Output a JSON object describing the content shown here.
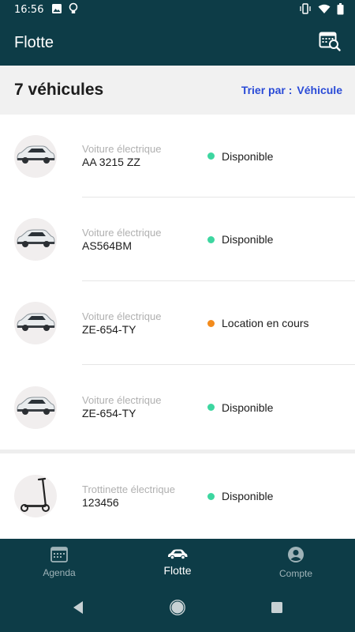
{
  "status_bar": {
    "time": "16:56"
  },
  "app_bar": {
    "title": "Flotte",
    "action_icon": "calendar-search-icon"
  },
  "summary": {
    "count_label": "7 véhicules",
    "sort_prefix": "Trier par :",
    "sort_value": "Véhicule"
  },
  "vehicles": [
    {
      "type": "Voiture électrique",
      "plate": "AA 3215 ZZ",
      "status": "Disponible",
      "status_color": "#3dd6a0",
      "icon": "car-icon"
    },
    {
      "type": "Voiture électrique",
      "plate": "AS564BM",
      "status": "Disponible",
      "status_color": "#3dd6a0",
      "icon": "car-icon"
    },
    {
      "type": "Voiture électrique",
      "plate": "ZE-654-TY",
      "status": "Location en cours",
      "status_color": "#f38b1c",
      "icon": "car-icon"
    },
    {
      "type": "Voiture électrique",
      "plate": "ZE-654-TY",
      "status": "Disponible",
      "status_color": "#3dd6a0",
      "icon": "car-icon"
    },
    {
      "type": "Trottinette électrique",
      "plate": "123456",
      "status": "Disponible",
      "status_color": "#3dd6a0",
      "icon": "scooter-icon"
    }
  ],
  "bottom_nav": [
    {
      "label": "Agenda",
      "icon": "calendar-icon",
      "active": false
    },
    {
      "label": "Flotte",
      "icon": "car-icon",
      "active": true
    },
    {
      "label": "Compte",
      "icon": "account-icon",
      "active": false
    }
  ],
  "colors": {
    "primary": "#0d3c47",
    "accent": "#2a4bd7",
    "available": "#3dd6a0",
    "in_progress": "#f38b1c"
  }
}
